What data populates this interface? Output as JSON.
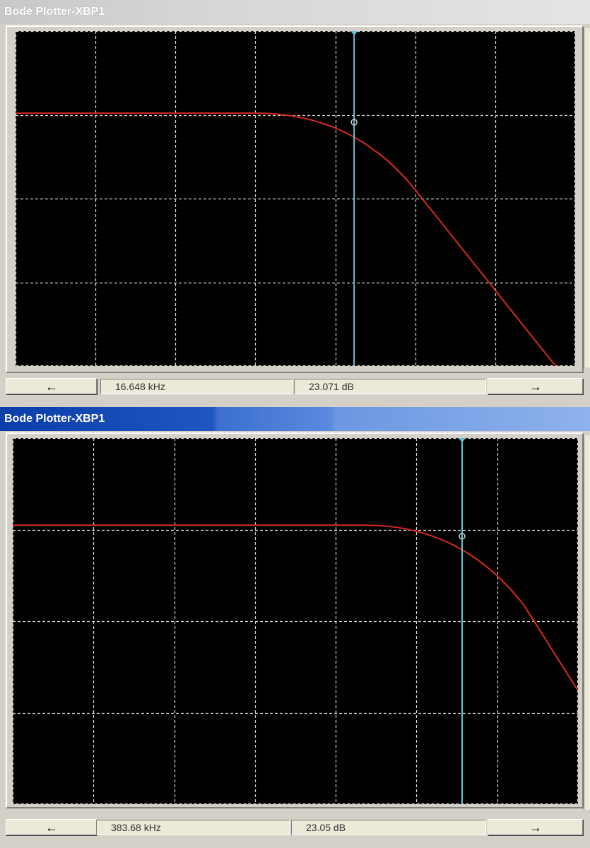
{
  "windows": [
    {
      "title": "Bode Plotter-XBP1",
      "active": false,
      "readout": {
        "frequency": "16.648 kHz",
        "gain": "23.071 dB"
      },
      "left_arrow": "←",
      "right_arrow": "→",
      "cursor_fraction": 0.605,
      "curve_color": "#d42a20",
      "cursor_color": "#5fc6d8"
    },
    {
      "title": "Bode Plotter-XBP1",
      "active": true,
      "readout": {
        "frequency": "383.68 kHz",
        "gain": "23.05 dB"
      },
      "left_arrow": "←",
      "right_arrow": "→",
      "cursor_fraction": 0.795,
      "curve_color": "#d42a20",
      "cursor_color": "#5fc6d8"
    }
  ]
}
